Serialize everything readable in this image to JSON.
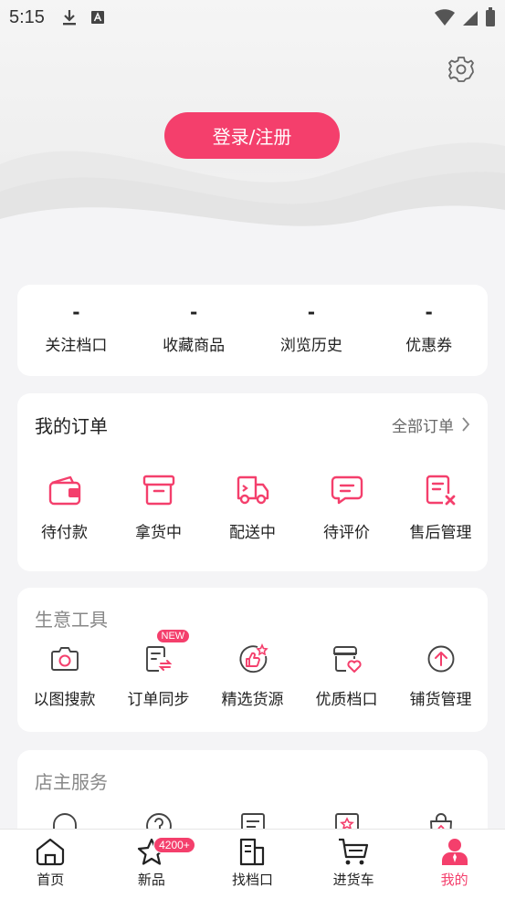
{
  "status_bar": {
    "time": "5:15"
  },
  "header": {
    "login_label": "登录/注册"
  },
  "stats": [
    {
      "value": "-",
      "label": "关注档口"
    },
    {
      "value": "-",
      "label": "收藏商品"
    },
    {
      "value": "-",
      "label": "浏览历史"
    },
    {
      "value": "-",
      "label": "优惠券"
    }
  ],
  "orders": {
    "title": "我的订单",
    "more_label": "全部订单",
    "items": [
      {
        "label": "待付款",
        "icon": "wallet-icon"
      },
      {
        "label": "拿货中",
        "icon": "box-icon"
      },
      {
        "label": "配送中",
        "icon": "truck-icon"
      },
      {
        "label": "待评价",
        "icon": "comment-icon"
      },
      {
        "label": "售后管理",
        "icon": "after-sale-icon"
      }
    ]
  },
  "tools": {
    "title": "生意工具",
    "new_badge": "NEW",
    "items": [
      {
        "label": "以图搜款",
        "icon": "camera-icon"
      },
      {
        "label": "订单同步",
        "icon": "order-sync-icon"
      },
      {
        "label": "精选货源",
        "icon": "thumbs-up-icon"
      },
      {
        "label": "优质档口",
        "icon": "store-heart-icon"
      },
      {
        "label": "铺货管理",
        "icon": "upload-icon"
      }
    ]
  },
  "service": {
    "title": "店主服务",
    "items": [
      {
        "icon": "headset-icon"
      },
      {
        "icon": "help-icon"
      },
      {
        "icon": "document-icon"
      },
      {
        "icon": "star-card-icon"
      },
      {
        "icon": "shopping-bag-icon"
      }
    ]
  },
  "tabbar": {
    "items": [
      {
        "label": "首页",
        "icon": "home-icon"
      },
      {
        "label": "新品",
        "icon": "star-icon",
        "badge": "4200+"
      },
      {
        "label": "找档口",
        "icon": "store-icon"
      },
      {
        "label": "进货车",
        "icon": "cart-icon"
      },
      {
        "label": "我的",
        "icon": "user-icon",
        "active": true
      }
    ]
  },
  "colors": {
    "accent": "#f43f6c",
    "background": "#f4f4f6"
  }
}
